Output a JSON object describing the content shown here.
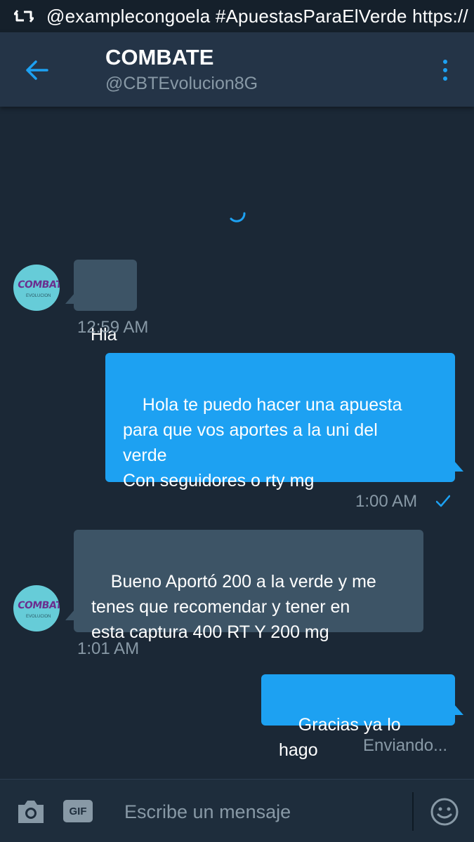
{
  "notification": {
    "text": "@examplecongoela  #ApuestasParaElVerde https://",
    "icon": "retweet-icon"
  },
  "header": {
    "title": "COMBATE",
    "handle": "@CBTEvolucion8G",
    "back_icon": "arrow-left-icon",
    "menu_icon": "more-vertical-icon"
  },
  "avatar": {
    "logo_text": "COMBATE",
    "logo_sub": "EVOLUCION"
  },
  "messages": [
    {
      "direction": "received",
      "text": "Hla",
      "time": "12:59 AM"
    },
    {
      "direction": "sent",
      "text": "Hola te puedo hacer una apuesta\npara que vos aportes a la uni del\nverde\nCon seguidores o rty mg",
      "time": "1:00 AM",
      "status_icon": "check-icon"
    },
    {
      "direction": "received",
      "text": "Bueno Aportó 200 a la verde y me\ntenes que recomendar y tener en\nesta captura 400 RT Y 200 mg",
      "time": "1:01 AM"
    },
    {
      "direction": "sent",
      "text": "Gracias ya lo hago",
      "status": "Enviando..."
    }
  ],
  "composer": {
    "placeholder": "Escribe un mensaje",
    "gif_label": "GIF",
    "camera_icon": "camera-icon",
    "emoji_icon": "smiley-icon"
  },
  "colors": {
    "background": "#1b2836",
    "header": "#243447",
    "accent": "#1da1f2",
    "received_bubble": "#3d5466",
    "muted_text": "#8899a6"
  }
}
